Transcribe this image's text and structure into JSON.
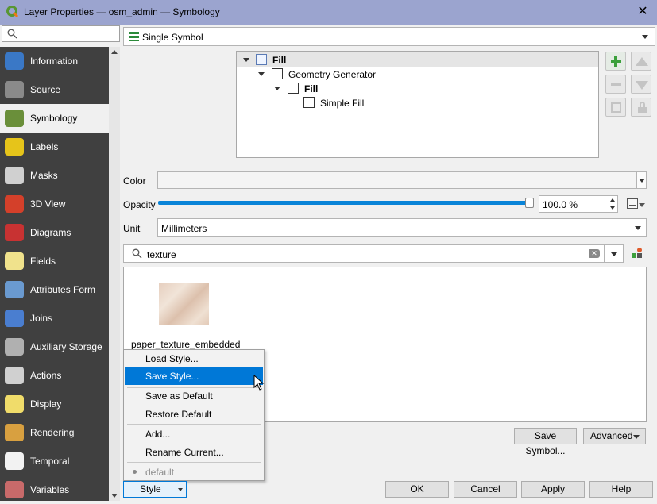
{
  "window": {
    "title": "Layer Properties — osm_admin — Symbology"
  },
  "sidebar": {
    "search_placeholder": "",
    "items": [
      {
        "label": "Information",
        "icon": "information-icon",
        "color": "#3a78c6"
      },
      {
        "label": "Source",
        "icon": "source-icon",
        "color": "#8a8a8a"
      },
      {
        "label": "Symbology",
        "icon": "symbology-icon",
        "color": "#6a8f3a",
        "active": true
      },
      {
        "label": "Labels",
        "icon": "labels-icon",
        "color": "#e6c41a"
      },
      {
        "label": "Masks",
        "icon": "masks-icon",
        "color": "#d0d0d0"
      },
      {
        "label": "3D View",
        "icon": "3d-view-icon",
        "color": "#d4402a"
      },
      {
        "label": "Diagrams",
        "icon": "diagrams-icon",
        "color": "#c83232"
      },
      {
        "label": "Fields",
        "icon": "fields-icon",
        "color": "#f0e28c"
      },
      {
        "label": "Attributes Form",
        "icon": "attributes-form-icon",
        "color": "#6a9ad0"
      },
      {
        "label": "Joins",
        "icon": "joins-icon",
        "color": "#4a7ed0"
      },
      {
        "label": "Auxiliary Storage",
        "icon": "auxiliary-storage-icon",
        "color": "#b0b0b0"
      },
      {
        "label": "Actions",
        "icon": "actions-icon",
        "color": "#d0d0d0"
      },
      {
        "label": "Display",
        "icon": "display-icon",
        "color": "#f0dc6a"
      },
      {
        "label": "Rendering",
        "icon": "rendering-icon",
        "color": "#d8a040"
      },
      {
        "label": "Temporal",
        "icon": "temporal-icon",
        "color": "#f2f2f2"
      },
      {
        "label": "Variables",
        "icon": "variables-icon",
        "color": "#c86a6a"
      }
    ]
  },
  "renderer": {
    "selected": "Single Symbol"
  },
  "symbol_tree": [
    {
      "label": "Fill",
      "bold": true,
      "level": 0
    },
    {
      "label": "Geometry Generator",
      "bold": false,
      "level": 1
    },
    {
      "label": "Fill",
      "bold": true,
      "level": 2
    },
    {
      "label": "Simple Fill",
      "bold": false,
      "level": 3
    }
  ],
  "properties": {
    "color_label": "Color",
    "opacity_label": "Opacity",
    "opacity_value": "100.0 %",
    "opacity_fraction": 1.0,
    "unit_label": "Unit",
    "unit_value": "Millimeters"
  },
  "library": {
    "search_value": "texture",
    "items": [
      {
        "label": "paper_texture_embedded"
      }
    ]
  },
  "buttons": {
    "save_symbol": "Save Symbol...",
    "advanced": "Advanced",
    "style": "Style",
    "ok": "OK",
    "cancel": "Cancel",
    "apply": "Apply",
    "help": "Help"
  },
  "style_menu": {
    "items": [
      "Load Style...",
      "Save Style...",
      "Save as Default",
      "Restore Default",
      "Add...",
      "Rename Current..."
    ],
    "current": "default"
  },
  "colors": {
    "accent": "#0078d7",
    "titlebar": "#9ba4cf",
    "sidebar": "#404040",
    "slider": "#0a84d8"
  }
}
